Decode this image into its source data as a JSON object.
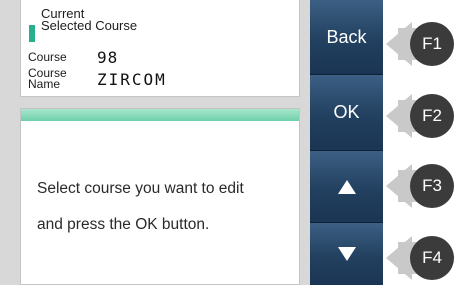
{
  "current_course": {
    "heading_line1": "Current",
    "heading_line2": "Selected Course",
    "course_label": "Course",
    "course_number": "98",
    "name_label_line1": "Course",
    "name_label_line2": "Name",
    "course_name": "ZIRCOM"
  },
  "message": {
    "line1": "Select course you want to edit",
    "line2": "and press the OK button."
  },
  "buttons": {
    "back": "Back",
    "ok": "OK"
  },
  "function_keys": [
    "F1",
    "F2",
    "F3",
    "F4"
  ],
  "colors": {
    "accent_teal": "#26b08c",
    "button_blue": "#22405f",
    "fkey_dark": "#3b3b3b"
  }
}
